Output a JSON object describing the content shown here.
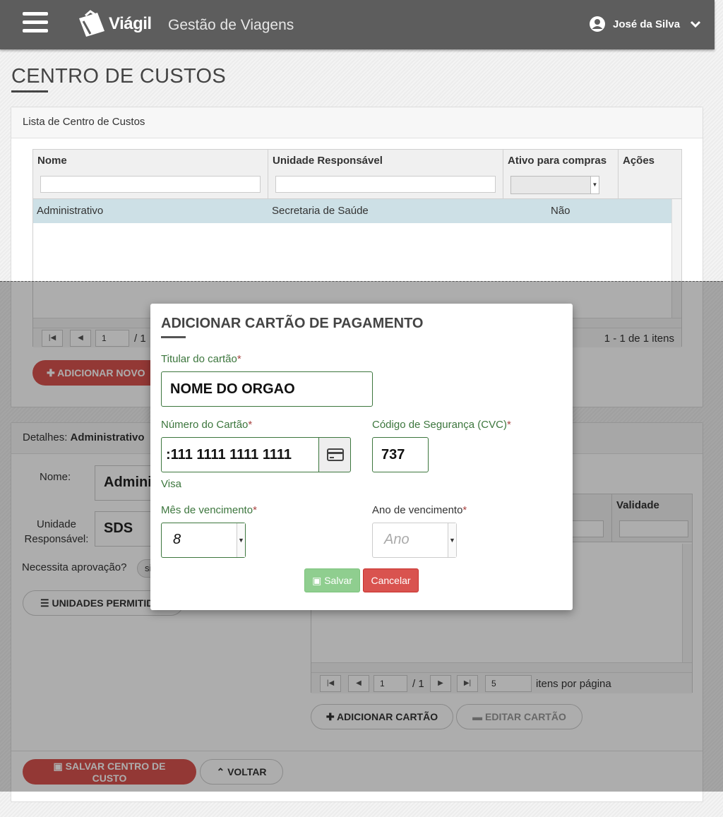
{
  "header": {
    "brand": "Viágil",
    "subtitle": "Gestão de Viagens",
    "user_name": "José da Silva"
  },
  "page": {
    "title": "CENTRO DE CUSTOS"
  },
  "list_panel": {
    "heading": "Lista de Centro de Custos",
    "columns": [
      "Nome",
      "Unidade Responsável",
      "Ativo para compras",
      "Ações"
    ],
    "rows": [
      {
        "nome": "Administrativo",
        "unidade": "Secretaria de Saúde",
        "ativo": "Não"
      }
    ],
    "pager": {
      "page": "1",
      "of": "/ 1",
      "summary": "1 - 1 de 1 itens"
    },
    "add_button": "ADICIONAR NOVO"
  },
  "details_panel": {
    "heading_prefix": "Detalhes:",
    "heading_name": "Administrativo",
    "nome_label": "Nome:",
    "nome_value": "Adminis",
    "unidade_label": "Unidade Responsável:",
    "unidade_value": "SDS",
    "aprovacao_label": "Necessita aprovação?",
    "aprovacao_value": "si",
    "unidades_button": "UNIDADES PERMITID",
    "cards_grid": {
      "validade_header": "Validade",
      "pager": {
        "page": "1",
        "of": "/ 1",
        "page_size": "5",
        "per_page_label": "itens por página"
      }
    },
    "add_card_button": "ADICIONAR CARTÃO",
    "edit_card_button": "EDITAR CARTÃO",
    "save_button": "SALVAR CENTRO DE CUSTO",
    "back_button": "VOLTAR"
  },
  "modal": {
    "title": "ADICIONAR CARTÃO DE PAGAMENTO",
    "holder_label": "Titular do cartão",
    "holder_value": "NOME DO ORGAO",
    "number_label": "Número do Cartão",
    "number_value": ":111 1111 1111 1111",
    "card_brand": "Visa",
    "cvc_label": "Código de Segurança (CVC)",
    "cvc_value": "737",
    "month_label": "Mês de vencimento",
    "month_value": "8",
    "year_label": "Ano de vencimento",
    "year_placeholder": "Ano",
    "required_mark": "*",
    "save_label": "Salvar",
    "cancel_label": "Cancelar"
  },
  "colors": {
    "header_bg": "#5d5d5d",
    "accent_red": "#d9534f",
    "success_green": "#3c763d",
    "row_selected": "#cde0e6"
  },
  "icons": {
    "menu": "hamburger-icon",
    "logo": "suitcase-logo-icon",
    "user": "user-circle-icon",
    "chevron": "chevron-down-icon",
    "card": "credit-card-icon",
    "plus": "plus-icon",
    "list": "list-icon",
    "save": "floppy-icon",
    "up": "chevron-up-icon"
  }
}
